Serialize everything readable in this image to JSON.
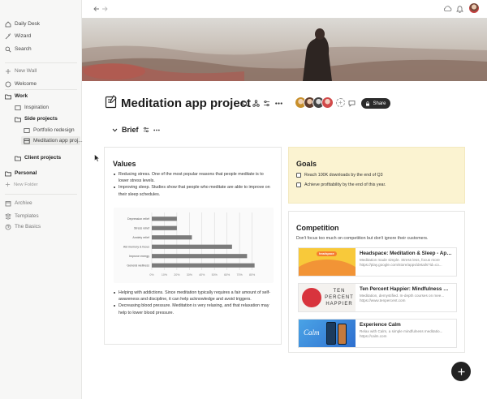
{
  "sidebar": {
    "items": [
      {
        "label": "Daily Desk",
        "icon": "home-icon"
      },
      {
        "label": "Wizard",
        "icon": "wand-icon"
      },
      {
        "label": "Search",
        "icon": "search-icon"
      },
      {
        "label": "New Wall",
        "icon": "plus-icon"
      },
      {
        "label": "Welcome",
        "icon": "smile-icon"
      }
    ],
    "work": {
      "label": "Work"
    },
    "work_children": [
      {
        "label": "Inspiration"
      },
      {
        "label": "Side projects"
      },
      {
        "label": "Portfolio redesign"
      },
      {
        "label": "Meditation app proj..."
      },
      {
        "label": "Client projects"
      }
    ],
    "personal": {
      "label": "Personal"
    },
    "new_folder": "New Folder",
    "bottom": [
      {
        "label": "Archive",
        "icon": "archive-icon"
      },
      {
        "label": "Templates",
        "icon": "templates-icon"
      },
      {
        "label": "The Basics",
        "icon": "help-icon"
      }
    ]
  },
  "page": {
    "title": "Meditation app project",
    "share_label": "Share",
    "brief_label": "Brief"
  },
  "values": {
    "heading": "Values",
    "bullets_top": [
      "Reducing stress. One of the most popular reasons that people meditate is to lower stress levels.",
      "Improving sleep. Studies show that people who meditate are able to improve on their sleep schedules."
    ],
    "bullets_bottom": [
      "Helping with addictions. Since meditation typically requires a fair amount of self-awareness and discipline, it can help acknowledge and avoid triggers.",
      "Decreasing blood pressure. Meditation is very relaxing, and that relaxation may help to lower blood pressure."
    ]
  },
  "goals": {
    "heading": "Goals",
    "items": [
      {
        "label": "Reach 100K downloads by the end of Q3",
        "checked": false
      },
      {
        "label": "Achieve profitability by the end of this year.",
        "checked": false
      }
    ]
  },
  "competition": {
    "heading": "Competition",
    "subtitle": "Don't focus too much on competition but don't ignore their customers.",
    "links": [
      {
        "title": "Headspace: Meditation & Sleep - App...",
        "desc": "Meditation made simple. Stress less, focus more",
        "url": "https://play.google.com/store/apps/details?id=co...",
        "thumb_text": "headspace"
      },
      {
        "title": "Ten Percent Happier: Mindfulness Me...",
        "desc": "Meditation, demystified. In-depth courses on mee...",
        "url": "https://www.tenpercent.com",
        "thumb_text": "TEN PERCENT HAPPIER"
      },
      {
        "title": "Experience Calm",
        "desc": "Relax with Calm, a simple mindfulness meditatio...",
        "url": "https://calm.com",
        "thumb_text": "Calm"
      }
    ]
  },
  "chart_data": {
    "type": "bar",
    "orientation": "horizontal",
    "categories": [
      "Depression relief",
      "Stress relief",
      "Anxiety relief",
      "Aid memory & focus",
      "Improve energy",
      "General wellness"
    ],
    "values": [
      20,
      20,
      32,
      64,
      76,
      82
    ],
    "xticks": [
      "0%",
      "10%",
      "20%",
      "30%",
      "40%",
      "50%",
      "60%",
      "70%",
      "80%"
    ],
    "xlim": [
      0,
      90
    ],
    "grid": true,
    "color": "#7b7b7b"
  },
  "colors": {
    "accent": "#222222",
    "goals_bg": "#fbf3d1"
  }
}
